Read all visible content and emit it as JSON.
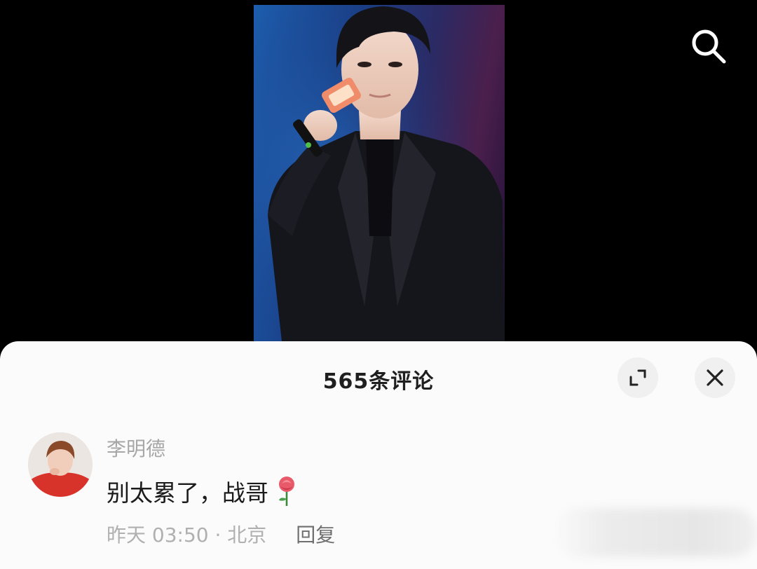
{
  "video": {
    "description_icon": "video-frame",
    "accent_colors": {
      "background_left": "#1d5fb0",
      "background_right": "#4b1f4c",
      "mic_label": "#f08c6a"
    }
  },
  "top_bar": {
    "search_icon": "search-icon"
  },
  "comments_sheet": {
    "title": "565条评论",
    "expand_icon": "expand-icon",
    "close_icon": "close-icon",
    "comments": [
      {
        "username": "李明德",
        "text": "别太累了，战哥",
        "emoji_icon": "rose-icon",
        "time_location": "昨天 03:50 · 北京",
        "reply_label": "回复"
      }
    ]
  }
}
